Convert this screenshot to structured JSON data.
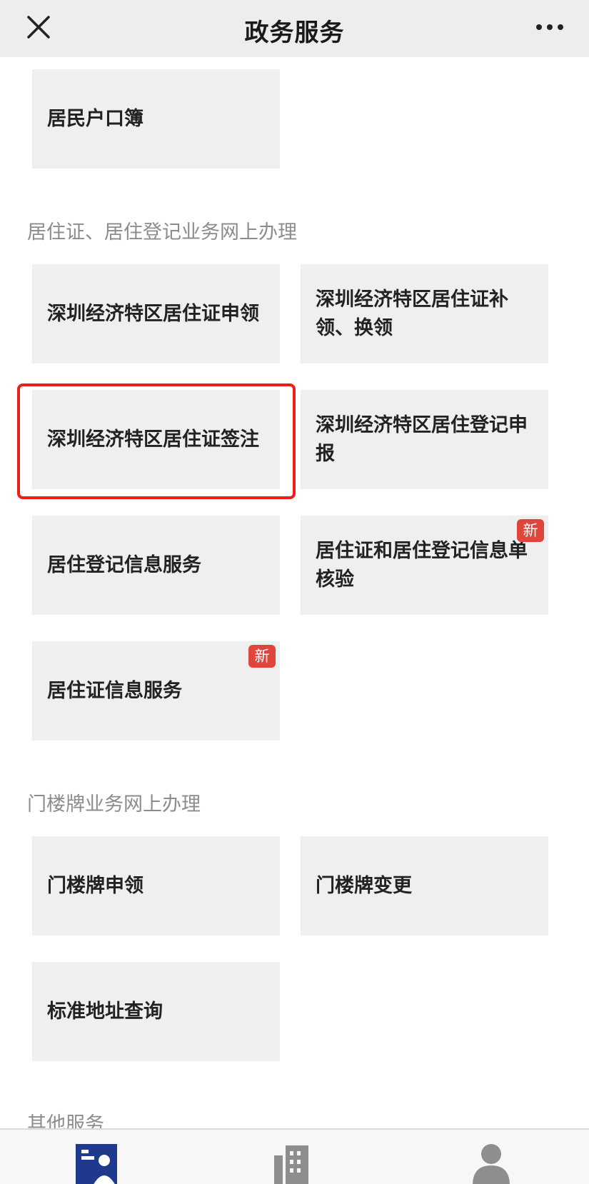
{
  "header": {
    "title": "政务服务",
    "close_icon": "close-icon",
    "more_icon": "more-icon"
  },
  "tiles": {
    "hukou": "居民户口簿",
    "permit_apply": "深圳经济特区居住证申领",
    "permit_reissue": "深圳经济特区居住证补领、换领",
    "permit_endorse": "深圳经济特区居住证签注",
    "reg_report": "深圳经济特区居住登记申报",
    "reg_info": "居住登记信息服务",
    "reg_verify": "居住证和居住登记信息单核验",
    "permit_info": "居住证信息服务",
    "doorplate_apply": "门楼牌申领",
    "doorplate_change": "门楼牌变更",
    "address_query": "标准地址查询"
  },
  "badges": {
    "new": "新"
  },
  "sections": {
    "residence": "居住证、居住登记业务网上办理",
    "doorplate": "门楼牌业务网上办理",
    "other": "其他服务"
  },
  "tabbar": {
    "tab1_icon": "service-card-icon",
    "tab2_icon": "building-icon",
    "tab3_icon": "user-icon"
  },
  "colors": {
    "header_bg": "#ededed",
    "tile_bg": "#efefef",
    "badge": "#e0453c",
    "highlight": "#f01c16",
    "tab_active": "#1f3a8c",
    "tab_inactive": "#8e8e8e"
  }
}
